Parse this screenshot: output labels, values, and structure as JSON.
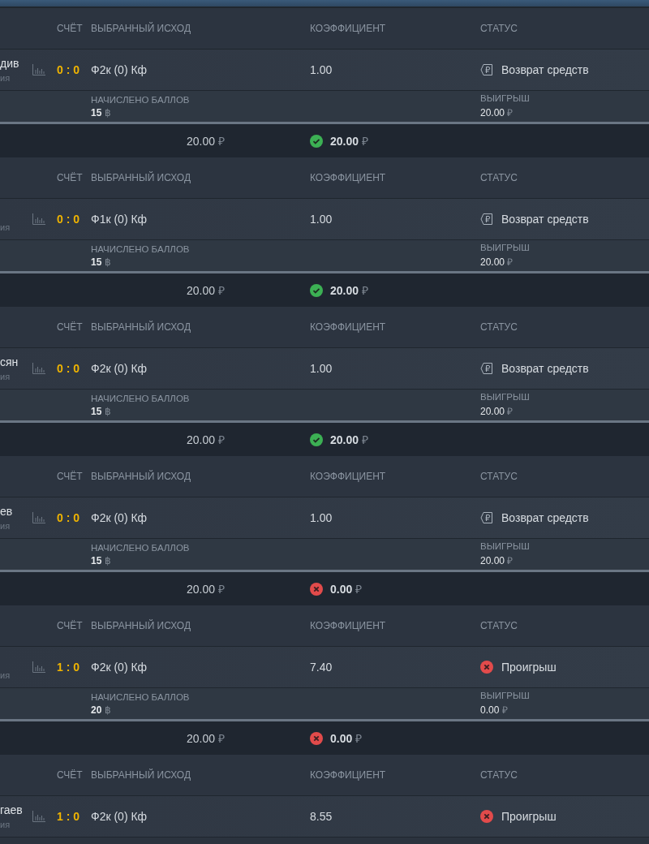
{
  "bets": [
    {
      "headers": {
        "score": "СЧЁТ",
        "outcome": "ВЫБРАННЫЙ ИСХОД",
        "coef": "КОЭФФИЦИЕНТ",
        "status": "СТАТУС"
      },
      "event": {
        "name": "див",
        "sub": "ия"
      },
      "score": "0 : 0",
      "outcome": "Ф2к (0) Кф",
      "coef": "1.00",
      "status": {
        "kind": "refund",
        "label": "Возврат средств"
      },
      "points": {
        "label": "НАЧИСЛЕНО БАЛЛОВ",
        "amount": "15",
        "unit": "฿"
      },
      "win": {
        "label": "ВЫИГРЫШ",
        "amount": "20.00",
        "currency": "₽"
      },
      "summary": {
        "stake": "20.00",
        "stake_currency": "₽",
        "kind": "win",
        "amount": "20.00",
        "currency": "₽"
      }
    },
    {
      "headers": {
        "score": "СЧЁТ",
        "outcome": "ВЫБРАННЫЙ ИСХОД",
        "coef": "КОЭФФИЦИЕНТ",
        "status": "СТАТУС"
      },
      "event": {
        "sub": "ия"
      },
      "score": "0 : 0",
      "outcome": "Ф1к (0) Кф",
      "coef": "1.00",
      "status": {
        "kind": "refund",
        "label": "Возврат средств"
      },
      "points": {
        "label": "НАЧИСЛЕНО БАЛЛОВ",
        "amount": "15",
        "unit": "฿"
      },
      "win": {
        "label": "ВЫИГРЫШ",
        "amount": "20.00",
        "currency": "₽"
      },
      "summary": {
        "stake": "20.00",
        "stake_currency": "₽",
        "kind": "win",
        "amount": "20.00",
        "currency": "₽"
      }
    },
    {
      "headers": {
        "score": "СЧЁТ",
        "outcome": "ВЫБРАННЫЙ ИСХОД",
        "coef": "КОЭФФИЦИЕНТ",
        "status": "СТАТУС"
      },
      "event": {
        "name": "сян",
        "sub": "ия"
      },
      "score": "0 : 0",
      "outcome": "Ф2к (0) Кф",
      "coef": "1.00",
      "status": {
        "kind": "refund",
        "label": "Возврат средств"
      },
      "points": {
        "label": "НАЧИСЛЕНО БАЛЛОВ",
        "amount": "15",
        "unit": "฿"
      },
      "win": {
        "label": "ВЫИГРЫШ",
        "amount": "20.00",
        "currency": "₽"
      },
      "summary": {
        "stake": "20.00",
        "stake_currency": "₽",
        "kind": "win",
        "amount": "20.00",
        "currency": "₽"
      }
    },
    {
      "headers": {
        "score": "СЧЁТ",
        "outcome": "ВЫБРАННЫЙ ИСХОД",
        "coef": "КОЭФФИЦИЕНТ",
        "status": "СТАТУС"
      },
      "event": {
        "name": "ев",
        "sub": "ия"
      },
      "score": "0 : 0",
      "outcome": "Ф2к (0) Кф",
      "coef": "1.00",
      "status": {
        "kind": "refund",
        "label": "Возврат средств"
      },
      "points": {
        "label": "НАЧИСЛЕНО БАЛЛОВ",
        "amount": "15",
        "unit": "฿"
      },
      "win": {
        "label": "ВЫИГРЫШ",
        "amount": "20.00",
        "currency": "₽"
      },
      "summary": {
        "stake": "20.00",
        "stake_currency": "₽",
        "kind": "loss",
        "amount": "0.00",
        "currency": "₽"
      }
    },
    {
      "headers": {
        "score": "СЧЁТ",
        "outcome": "ВЫБРАННЫЙ ИСХОД",
        "coef": "КОЭФФИЦИЕНТ",
        "status": "СТАТУС"
      },
      "event": {
        "sub": "ия"
      },
      "score": "1 : 0",
      "outcome": "Ф2к (0) Кф",
      "coef": "7.40",
      "status": {
        "kind": "loss",
        "label": "Проигрыш"
      },
      "points": {
        "label": "НАЧИСЛЕНО БАЛЛОВ",
        "amount": "20",
        "unit": "฿"
      },
      "win": {
        "label": "ВЫИГРЫШ",
        "amount": "0.00",
        "currency": "₽"
      },
      "summary": {
        "stake": "20.00",
        "stake_currency": "₽",
        "kind": "loss",
        "amount": "0.00",
        "currency": "₽"
      }
    },
    {
      "headers": {
        "score": "СЧЁТ",
        "outcome": "ВЫБРАННЫЙ ИСХОД",
        "coef": "КОЭФФИЦИЕНТ",
        "status": "СТАТУС"
      },
      "event": {
        "name": "гаев",
        "sub": "ия"
      },
      "score": "1 : 0",
      "outcome": "Ф2к (0) Кф",
      "coef": "8.55",
      "status": {
        "kind": "loss",
        "label": "Проигрыш"
      }
    }
  ]
}
